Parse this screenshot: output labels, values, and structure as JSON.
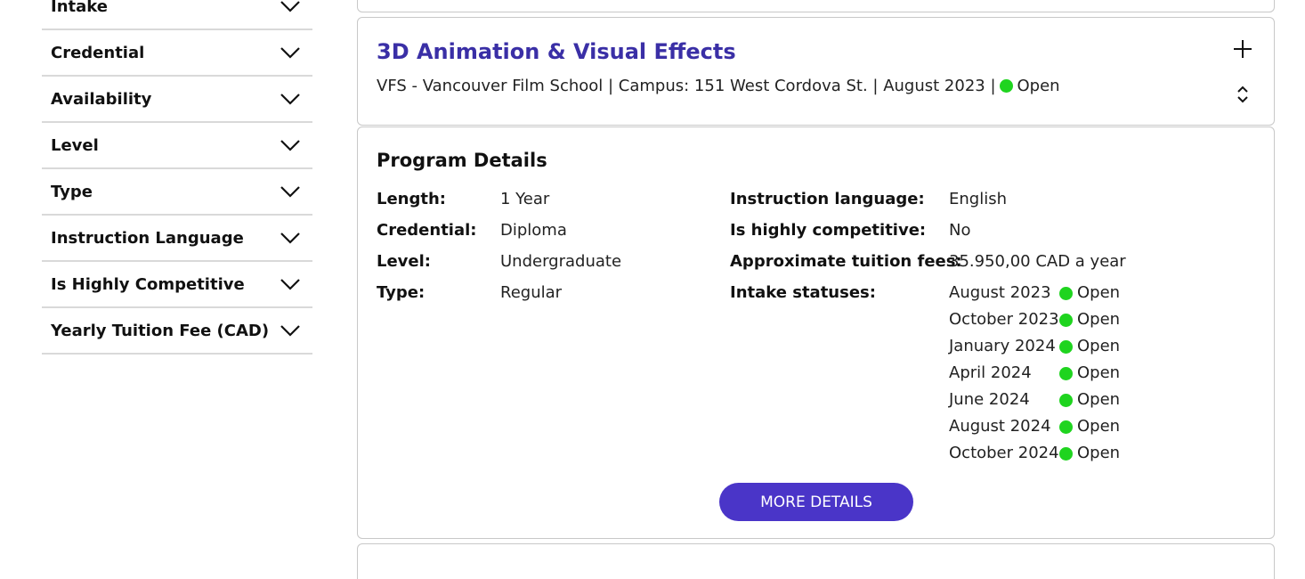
{
  "filters": [
    {
      "label": "Intake"
    },
    {
      "label": "Credential"
    },
    {
      "label": "Availability"
    },
    {
      "label": "Level"
    },
    {
      "label": "Type"
    },
    {
      "label": "Instruction Language"
    },
    {
      "label": "Is Highly Competitive"
    },
    {
      "label": "Yearly Tuition Fee (CAD)"
    }
  ],
  "program": {
    "title": "3D Animation & Visual Effects",
    "subtitle": "VFS - Vancouver Film School | Campus: 151 West Cordova St. | August 2023 |",
    "status": "Open",
    "status_color": "#1fd41f"
  },
  "details": {
    "title": "Program Details",
    "left": [
      {
        "label": "Length:",
        "value": "1 Year"
      },
      {
        "label": "Credential:",
        "value": "Diploma"
      },
      {
        "label": "Level:",
        "value": "Undergraduate"
      },
      {
        "label": "Type:",
        "value": "Regular"
      }
    ],
    "right": [
      {
        "label": "Instruction language:",
        "value": "English"
      },
      {
        "label": "Is highly competitive:",
        "value": "No"
      },
      {
        "label": "Approximate tuition fees:",
        "value": "35.950,00 CAD a year"
      },
      {
        "label": "Intake statuses:",
        "value": ""
      }
    ],
    "intakes": [
      {
        "date": "August 2023",
        "status": "Open"
      },
      {
        "date": "October 2023",
        "status": "Open"
      },
      {
        "date": "January 2024",
        "status": "Open"
      },
      {
        "date": "April 2024",
        "status": "Open"
      },
      {
        "date": "June 2024",
        "status": "Open"
      },
      {
        "date": "August 2024",
        "status": "Open"
      },
      {
        "date": "October 2024",
        "status": "Open"
      }
    ],
    "more_button": "MORE DETAILS"
  },
  "colors": {
    "accent": "#4a35c8",
    "title": "#3a2fa6",
    "open": "#1fd41f"
  }
}
